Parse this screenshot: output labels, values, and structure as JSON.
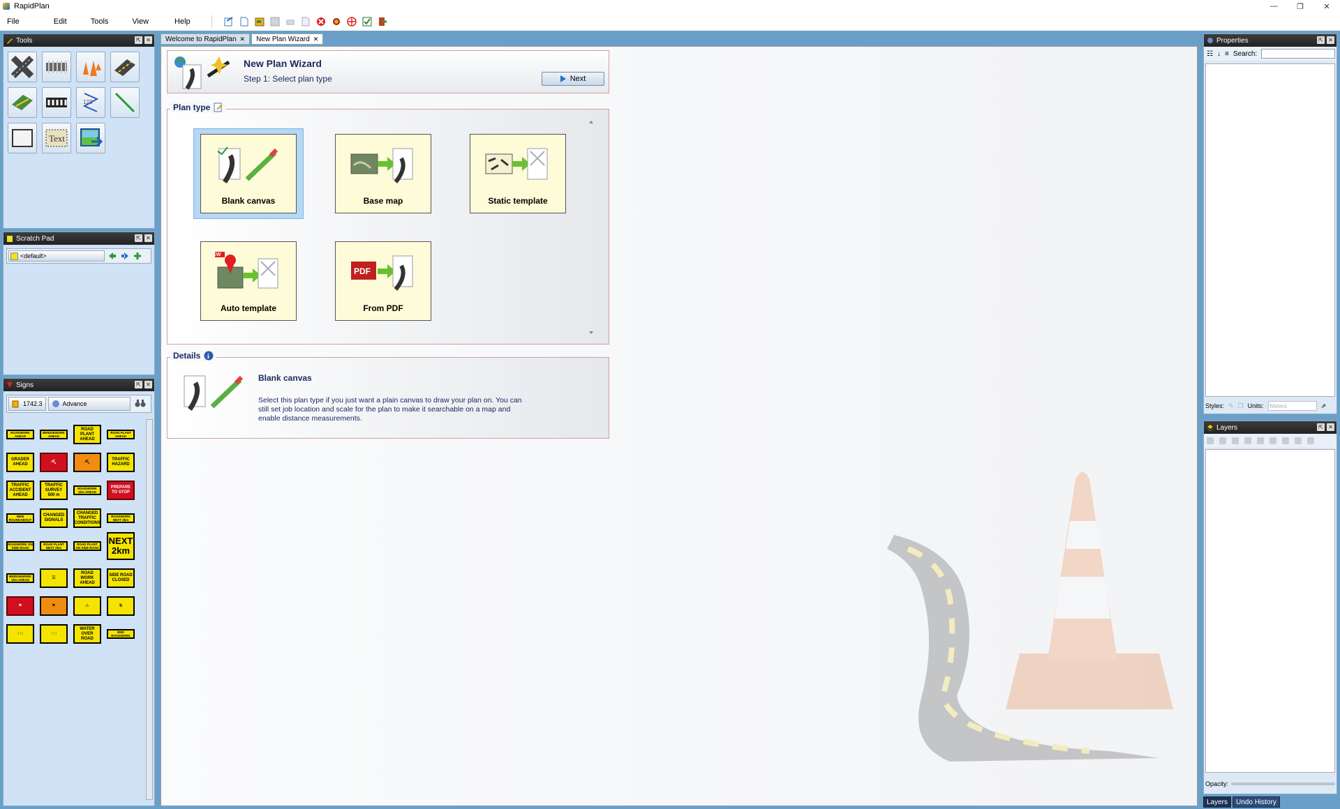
{
  "window": {
    "title": "RapidPlan",
    "controls": [
      "—",
      "❐",
      "✕"
    ]
  },
  "menu": [
    "File",
    "Edit",
    "Tools",
    "View",
    "Help"
  ],
  "toolbar_icons": [
    "open-icon",
    "new-icon",
    "open-folder-icon",
    "save-icon",
    "print-icon",
    "export-icon",
    "delete-icon",
    "settings-icon",
    "target-icon",
    "check-icon",
    "exit-icon"
  ],
  "panes": {
    "tools": {
      "title": "Tools"
    },
    "scratch": {
      "title": "Scratch Pad",
      "value": "<default>"
    },
    "signs": {
      "title": "Signs",
      "code": "1742.3",
      "category": "Advance"
    }
  },
  "signs": [
    {
      "t": "ROADWORK AHEAD",
      "s": "small"
    },
    {
      "t": "BRIDGEWORK AHEAD",
      "s": "small"
    },
    {
      "t": "ROAD PLANT AHEAD",
      "s": ""
    },
    {
      "t": "ROAD PLANT AHEAD",
      "s": "small"
    },
    {
      "t": "GRADER AHEAD",
      "s": ""
    },
    {
      "t": "⛏",
      "s": "red"
    },
    {
      "t": "⛏",
      "s": "orange"
    },
    {
      "t": "TRAFFIC HAZARD",
      "s": ""
    },
    {
      "t": "TRAFFIC ACCIDENT AHEAD",
      "s": ""
    },
    {
      "t": "TRAFFIC SURVEY 500 m",
      "s": ""
    },
    {
      "t": "ROADWORK 1km AHEAD",
      "s": "small"
    },
    {
      "t": "PREPARE TO STOP",
      "s": "red"
    },
    {
      "t": "NEW ROUNDABOUT",
      "s": "small"
    },
    {
      "t": "CHANGED SIGNALS",
      "s": ""
    },
    {
      "t": "CHANGED TRAFFIC CONDITIONS",
      "s": ""
    },
    {
      "t": "ROADWORK NEXT 2km",
      "s": "small"
    },
    {
      "t": "ROADWORK ON SIDE ROAD",
      "s": "small"
    },
    {
      "t": "ROAD PLANT NEXT 2km",
      "s": "small"
    },
    {
      "t": "ROAD PLANT ON SIDE ROAD",
      "s": "small"
    },
    {
      "t": "NEXT 2km",
      "s": "big"
    },
    {
      "t": "BRIDGEWORK 1km AHEAD",
      "s": "small"
    },
    {
      "t": "☰",
      "s": ""
    },
    {
      "t": "ROAD WORK AHEAD",
      "s": ""
    },
    {
      "t": "SIDE ROAD CLOSED",
      "s": ""
    },
    {
      "t": "⚑",
      "s": "red"
    },
    {
      "t": "⚑",
      "s": "orange"
    },
    {
      "t": "⚠",
      "s": ""
    },
    {
      "t": "⇅",
      "s": ""
    },
    {
      "t": "↑↑↑",
      "s": ""
    },
    {
      "t": "↑↑↑",
      "s": ""
    },
    {
      "t": "WATER OVER ROAD",
      "s": ""
    },
    {
      "t": "END ROADWORK",
      "s": "small"
    }
  ],
  "tabs": [
    {
      "label": "Welcome to RapidPlan",
      "active": false
    },
    {
      "label": "New Plan Wizard",
      "active": true
    }
  ],
  "wizard": {
    "title": "New Plan Wizard",
    "step": "Step 1: Select plan type",
    "next_label": "Next",
    "plan_type_label": "Plan type",
    "options": [
      "Blank canvas",
      "Base map",
      "Static template",
      "Auto template",
      "From PDF"
    ],
    "selected": "Blank canvas",
    "details_label": "Details",
    "details_title": "Blank canvas",
    "details_text": "Select this plan type if you just want a plain canvas to draw your plan on. You can still set job location and scale for the plan to make it searchable on a map and enable distance measurements."
  },
  "properties": {
    "title": "Properties",
    "search_label": "Search:",
    "styles_label": "Styles:",
    "units_label": "Units:",
    "units_value": "Meters"
  },
  "layers": {
    "title": "Layers",
    "opacity_label": "Opacity:"
  },
  "bottom_tabs": [
    "Layers",
    "Undo History"
  ]
}
